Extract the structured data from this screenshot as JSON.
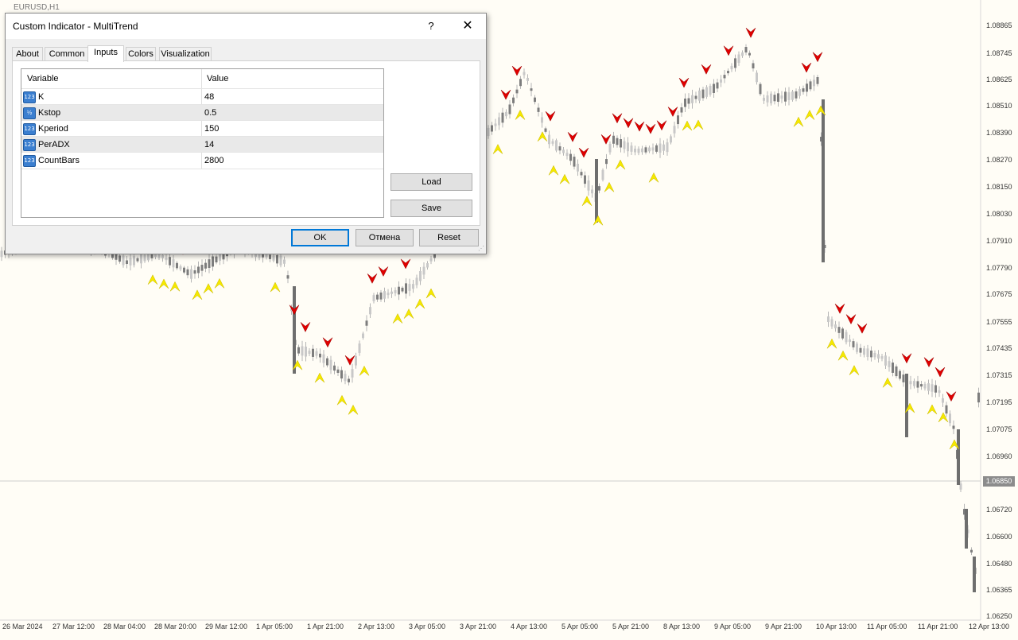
{
  "chart": {
    "symbol_label": "EURUSD,H1",
    "price_labels": [
      "1.08865",
      "1.08745",
      "1.08625",
      "1.08510",
      "1.08390",
      "1.08270",
      "1.08150",
      "1.08030",
      "1.07910",
      "1.07790",
      "1.07675",
      "1.07555",
      "1.07435",
      "1.07315",
      "1.07195",
      "1.07075",
      "1.06960",
      "1.06720",
      "1.06600",
      "1.06480",
      "1.06365",
      "1.06250"
    ],
    "current_price": "1.06850",
    "date_labels": [
      "26 Mar 2024",
      "27 Mar 12:00",
      "28 Mar 04:00",
      "28 Mar 20:00",
      "29 Mar 12:00",
      "1 Apr 05:00",
      "1 Apr 21:00",
      "2 Apr 13:00",
      "3 Apr 05:00",
      "3 Apr 21:00",
      "4 Apr 13:00",
      "5 Apr 05:00",
      "5 Apr 21:00",
      "8 Apr 13:00",
      "9 Apr 05:00",
      "9 Apr 21:00",
      "10 Apr 13:00",
      "11 Apr 05:00",
      "11 Apr 21:00",
      "12 Apr 13:00"
    ],
    "colors": {
      "background": "#fffdf6",
      "candle": "#7d7d7d",
      "sell_arrow": "#e00000",
      "buy_arrow": "#f5e800"
    }
  },
  "dialog": {
    "title": "Custom Indicator - MultiTrend",
    "help_glyph": "?",
    "close_glyph": "✕",
    "tabs": [
      {
        "label": "About"
      },
      {
        "label": "Common"
      },
      {
        "label": "Inputs"
      },
      {
        "label": "Colors"
      },
      {
        "label": "Visualization"
      }
    ],
    "active_tab": "Inputs",
    "grid": {
      "col_variable": "Variable",
      "col_value": "Value",
      "rows": [
        {
          "icon": "123",
          "name": "K",
          "value": "48"
        },
        {
          "icon": "½",
          "name": "Kstop",
          "value": "0.5"
        },
        {
          "icon": "123",
          "name": "Kperiod",
          "value": "150"
        },
        {
          "icon": "123",
          "name": "PerADX",
          "value": "14"
        },
        {
          "icon": "123",
          "name": "CountBars",
          "value": "2800"
        }
      ]
    },
    "load_label": "Load",
    "save_label": "Save",
    "ok_label": "OK",
    "cancel_label": "Отмена",
    "reset_label": "Reset"
  }
}
